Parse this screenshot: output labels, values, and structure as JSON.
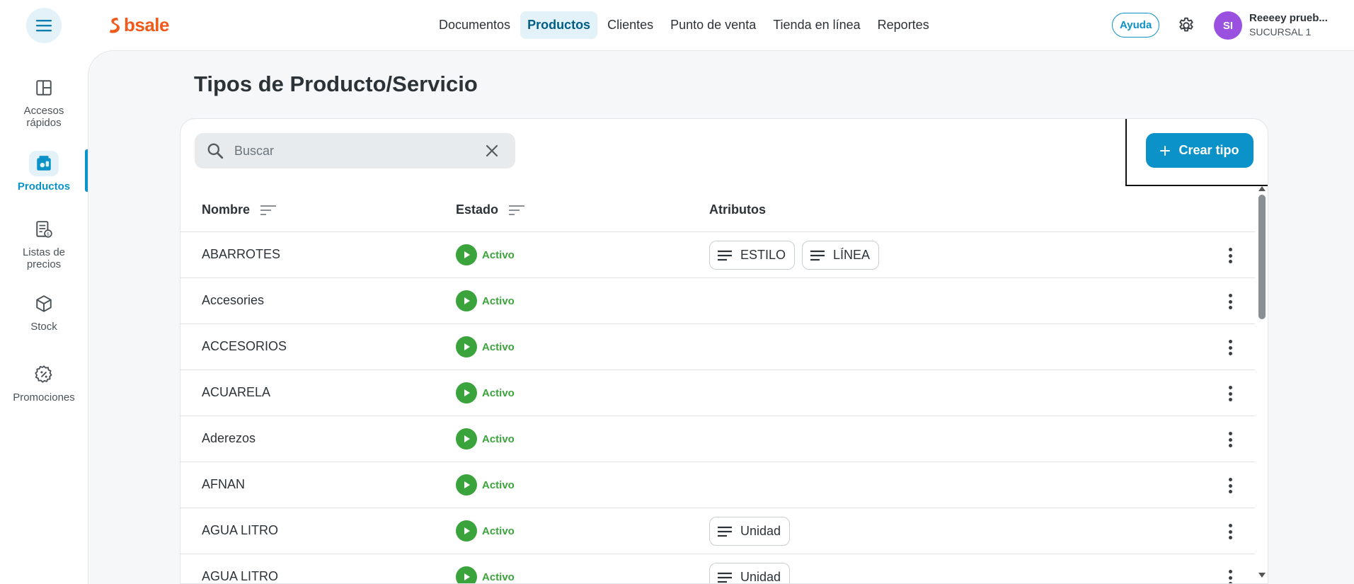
{
  "topbar": {
    "logo": "bsale",
    "nav": [
      {
        "label": "Documentos",
        "active": false
      },
      {
        "label": "Productos",
        "active": true
      },
      {
        "label": "Clientes",
        "active": false
      },
      {
        "label": "Punto de venta",
        "active": false
      },
      {
        "label": "Tienda en línea",
        "active": false
      },
      {
        "label": "Reportes",
        "active": false
      }
    ],
    "help_label": "Ayuda",
    "avatar_initials": "SI",
    "user_name": "Reeeey prueb...",
    "user_branch": "SUCURSAL 1"
  },
  "sidebar": {
    "items": [
      {
        "label": "Accesos rápidos",
        "icon": "layout-icon",
        "active": false
      },
      {
        "label": "Productos",
        "icon": "products-icon",
        "active": true
      },
      {
        "label": "Listas de precios",
        "icon": "price-list-icon",
        "active": false
      },
      {
        "label": "Stock",
        "icon": "box-icon",
        "active": false
      },
      {
        "label": "Promociones",
        "icon": "promo-icon",
        "active": false
      }
    ]
  },
  "page": {
    "title": "Tipos de Producto/Servicio"
  },
  "search": {
    "placeholder": "Buscar",
    "value": ""
  },
  "create_button_label": "Crear tipo",
  "table": {
    "columns": [
      "Nombre",
      "Estado",
      "Atributos"
    ],
    "rows": [
      {
        "name": "ABARROTES",
        "status": "Activo",
        "attributes": [
          "ESTILO",
          "LÍNEA"
        ]
      },
      {
        "name": "Accesories",
        "status": "Activo",
        "attributes": []
      },
      {
        "name": "ACCESORIOS",
        "status": "Activo",
        "attributes": []
      },
      {
        "name": "ACUARELA",
        "status": "Activo",
        "attributes": []
      },
      {
        "name": "Aderezos",
        "status": "Activo",
        "attributes": []
      },
      {
        "name": "AFNAN",
        "status": "Activo",
        "attributes": []
      },
      {
        "name": "AGUA LITRO",
        "status": "Activo",
        "attributes": [
          "Unidad"
        ]
      },
      {
        "name": "AGUA LITRO",
        "status": "Activo",
        "attributes": [
          "Unidad"
        ]
      }
    ]
  },
  "colors": {
    "brand": "#f05a1a",
    "primary": "#0b92c8",
    "active_status": "#3ba33b",
    "avatar": "#9b51e0"
  }
}
